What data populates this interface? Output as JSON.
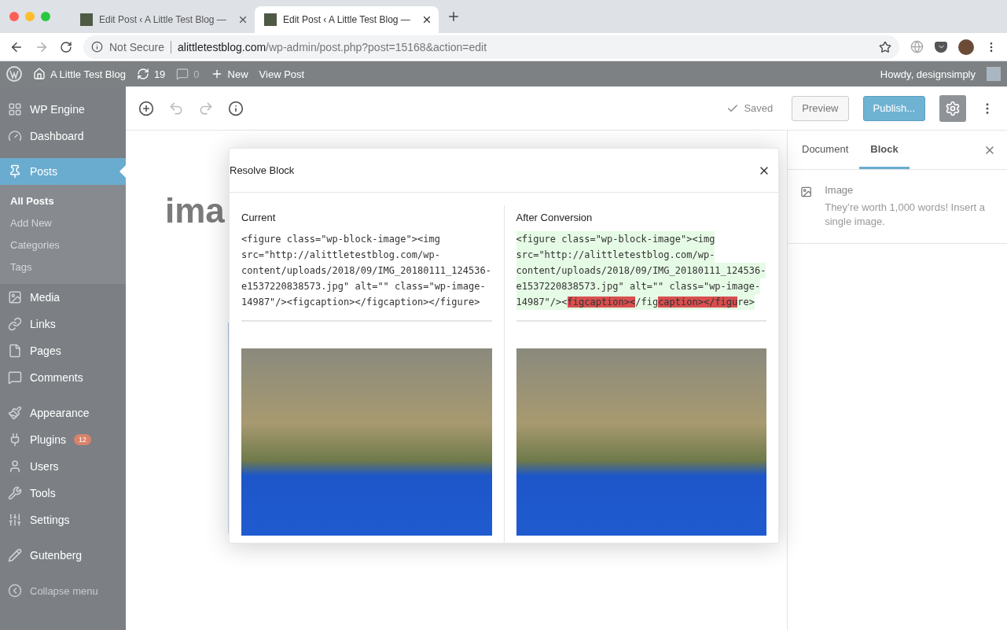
{
  "browser": {
    "tabs": [
      {
        "title": "Edit Post ‹ A Little Test Blog —",
        "selected": false
      },
      {
        "title": "Edit Post ‹ A Little Test Blog —",
        "selected": true
      }
    ],
    "security": "Not Secure",
    "url_domain": "alittletestblog.com",
    "url_path": "/wp-admin/post.php?post=15168&action=edit"
  },
  "admin_bar": {
    "items": [
      {
        "label": "A Little Test Blog"
      },
      {
        "label": "19"
      },
      {
        "label": "0"
      },
      {
        "label": "New"
      },
      {
        "label": "View Post"
      }
    ],
    "greeting": "Howdy, designsimply"
  },
  "admin_menu": {
    "groups": [
      [
        {
          "label": "WP Engine",
          "selected": false
        },
        {
          "label": "Dashboard",
          "selected": false
        }
      ],
      [
        {
          "label": "Posts",
          "selected": true,
          "children": [
            {
              "label": "All Posts",
              "selected": true
            },
            {
              "label": "Add New",
              "selected": false
            },
            {
              "label": "Categories",
              "selected": false
            },
            {
              "label": "Tags",
              "selected": false
            }
          ]
        },
        {
          "label": "Media",
          "selected": false
        },
        {
          "label": "Links",
          "selected": false
        },
        {
          "label": "Pages",
          "selected": false
        },
        {
          "label": "Comments",
          "selected": false
        }
      ],
      [
        {
          "label": "Appearance",
          "selected": false
        },
        {
          "label": "Plugins",
          "selected": false,
          "badge": "12"
        },
        {
          "label": "Users",
          "selected": false
        },
        {
          "label": "Tools",
          "selected": false
        },
        {
          "label": "Settings",
          "selected": false
        }
      ],
      [
        {
          "label": "Gutenberg",
          "selected": false
        }
      ]
    ],
    "collapse": "Collapse menu"
  },
  "toolbar": {
    "status": "Saved",
    "preview": "Preview",
    "publish": "Publish...",
    "settings_open": true
  },
  "editor": {
    "title": "ima"
  },
  "settings_sidebar": {
    "tabs": [
      {
        "label": "Document",
        "selected": false
      },
      {
        "label": "Block",
        "selected": true
      }
    ],
    "block_title": "Image",
    "block_description": "They’re worth 1,000 words! Insert a single image."
  },
  "modal": {
    "title": "Resolve Block",
    "current": {
      "heading": "Current",
      "lines": [
        "<figure class=\"wp-block-image\"><img",
        "src=\"http://alittletestblog.com/wp-",
        "content/uploads/2018/09/IMG_20180111_124536-",
        "e1537220838573.jpg\" alt=\"\" class=\"wp-image-",
        "14987\"/><figcaption></figcaption></figure>"
      ]
    },
    "converted": {
      "heading": "After Conversion",
      "lines": [
        [
          {
            "text": "<figure class=\"wp-block-image\"><img",
            "removed": false
          }
        ],
        [
          {
            "text": "src=\"http://alittletestblog.com/wp-",
            "removed": false
          }
        ],
        [
          {
            "text": "content/uploads/2018/09/IMG_20180111_124536-",
            "removed": false
          }
        ],
        [
          {
            "text": "e1537220838573.jpg\" alt=\"\" class=\"wp-image-",
            "removed": false
          }
        ],
        [
          {
            "text": "14987\"/><",
            "removed": false
          },
          {
            "text": "figcaption><",
            "removed": true
          },
          {
            "text": "/fig",
            "removed": false
          },
          {
            "text": "caption></figu",
            "removed": true
          },
          {
            "text": "re>",
            "removed": false
          }
        ]
      ]
    }
  }
}
